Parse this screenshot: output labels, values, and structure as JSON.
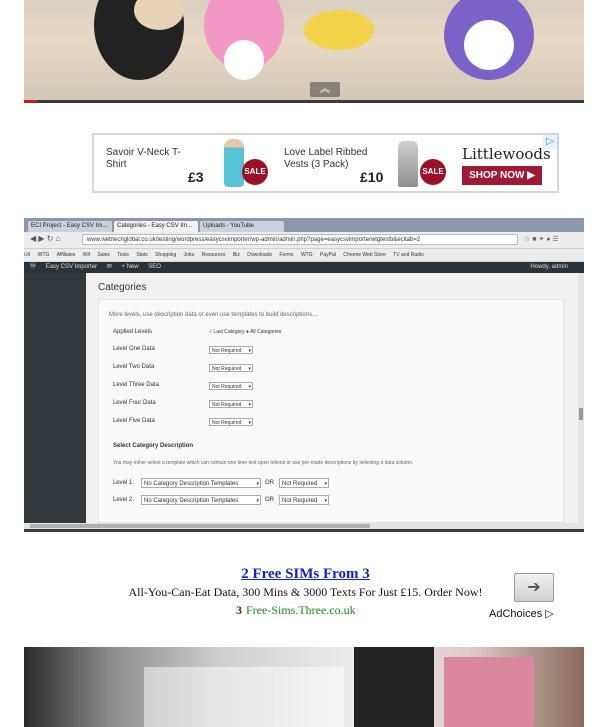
{
  "video1": {
    "progress_fraction": 0.023,
    "expand_label": "︽"
  },
  "ad1": {
    "product1": {
      "name": "Savoir V-Neck T-Shirt",
      "price": "£3",
      "badge": "SALE"
    },
    "product2": {
      "name": "Love Label Ribbed Vests (3 Pack)",
      "price": "£10",
      "badge": "SALE"
    },
    "brand": "Littlewoods",
    "cta": "SHOP NOW ▶"
  },
  "shot": {
    "tabs": [
      "ECI Project - Easy CSV Im...",
      "Categories - Easy CSV Im...",
      "Uploads - YouTube"
    ],
    "url": "www.webtechglobal.co.uk/testing/wordpress/easycsvimporter/wp-admin/admin.php?page=easycsvimporterwtgtestb&ecitab=2",
    "bookmarks": [
      "Url",
      "WTG",
      "Affiliates",
      "Wif",
      "Sales",
      "Tools",
      "Stats",
      "Shopping",
      "Jobs",
      "Resources",
      "Biz",
      "Downloads",
      "Forms",
      "WTG",
      "PayPal",
      "Chrome Web Store",
      "TV and Radio"
    ],
    "wpbar": {
      "site": "Easy CSV Importer",
      "new": "+ New",
      "seo": "SEO",
      "howdy": "Howdy, admin"
    },
    "page_title": "Categories",
    "intro": "More levels, use description data or even use templates to build descriptions...",
    "applied_levels": {
      "label": "Applied Levels",
      "opt1": "Last Category",
      "opt2": "All Categories"
    },
    "levels": [
      {
        "label": "Level One Data",
        "value": "Not Required"
      },
      {
        "label": "Level Two Data",
        "value": "Not Required"
      },
      {
        "label": "Level Three Data",
        "value": "Not Required"
      },
      {
        "label": "Level Four Data",
        "value": "Not Required"
      },
      {
        "label": "Level Five Data",
        "value": "Not Required"
      }
    ],
    "desc_heading": "Select Category Description",
    "desc_note": "You may either select a template which can contain one time text open tokens or use pre-made descriptions by selecting a data column.",
    "desc_rows": [
      {
        "label": "Level 1:",
        "template": "No Category Description Templates",
        "or": "OR",
        "value": "Not Required"
      },
      {
        "label": "Level 2:",
        "template": "No Category Description Templates",
        "or": "OR",
        "value": "Not Required"
      }
    ],
    "progress_fraction": 0.27
  },
  "ad2": {
    "title": "2 Free SIMs From 3",
    "desc": "All-You-Can-Eat Data, 300 Mins & 3000 Texts For Just £15. Order Now!",
    "url_icon": "3",
    "url": "Free-Sims.Three.co.uk",
    "button": "➔",
    "adchoices": "AdChoices ▷"
  },
  "colors": {
    "accent_red": "#cc1a1a",
    "ad_link_blue": "#1122cc",
    "ad_url_green": "#1a8a1a",
    "littlewoods_red": "#a11a33"
  }
}
